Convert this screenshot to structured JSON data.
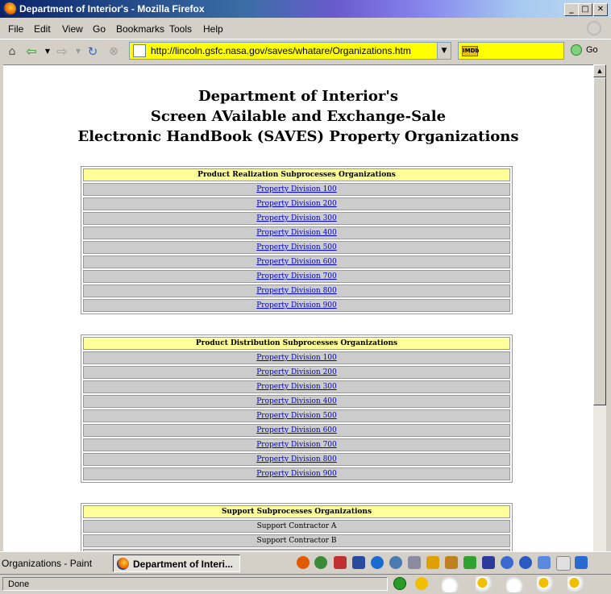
{
  "window": {
    "title": "Department of Interior's - Mozilla Firefox",
    "min_label": "_",
    "max_label": "□",
    "close_label": "✕"
  },
  "menu": [
    "File",
    "Edit",
    "View",
    "Go",
    "Bookmarks",
    "Tools",
    "Help"
  ],
  "nav": {
    "url": "http://lincoln.gsfc.nasa.gov/saves/whatare/Organizations.htm",
    "search_value": "",
    "go_label": "Go"
  },
  "page": {
    "heading_lines": [
      "Department of Interior's",
      "Screen AVailable and Exchange-Sale",
      "Electronic HandBook (SAVES) Property Organizations"
    ],
    "tables": [
      {
        "header": "Product Realization Subprocesses Organizations",
        "rows": [
          "Property Division 100",
          "Property Division 200",
          "Property Division 300",
          "Property Division 400",
          "Property Division 500",
          "Property Division 600",
          "Property Division 700",
          "Property Division 800",
          "Property Division 900"
        ],
        "links": true
      },
      {
        "header": "Product Distribution Subprocesses Organizations",
        "rows": [
          "Property Division 100",
          "Property Division 200",
          "Property Division 300",
          "Property Division 400",
          "Property Division 500",
          "Property Division 600",
          "Property Division 700",
          "Property Division 800",
          "Property Division 900"
        ],
        "links": true
      },
      {
        "header": "Support Subprocesses Organizations",
        "rows": [
          "Support Contractor A",
          "Support Contractor B"
        ],
        "links": false
      }
    ]
  },
  "taskbar": {
    "items": [
      "Organizations - Paint",
      "Department of Interi..."
    ]
  },
  "status": {
    "text": "Done"
  }
}
